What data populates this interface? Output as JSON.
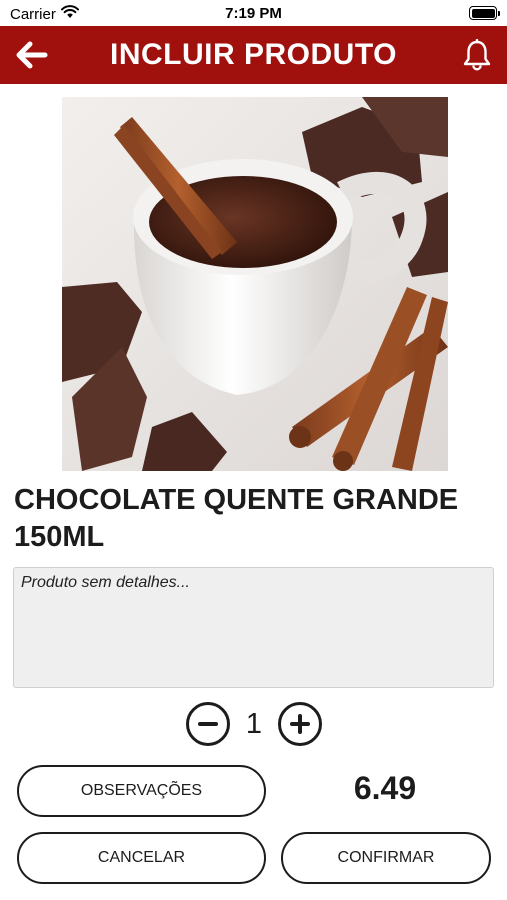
{
  "status_bar": {
    "carrier": "Carrier",
    "time": "7:19 PM",
    "icons": [
      "wifi-icon",
      "battery-icon"
    ]
  },
  "header": {
    "title": "INCLUIR PRODUTO",
    "background": "#a0100c",
    "icons": [
      "arrow-left-icon",
      "bell-icon"
    ]
  },
  "product": {
    "image_alt": "hot-chocolate-photo",
    "name": "CHOCOLATE QUENTE GRANDE 150ML",
    "details": "Produto sem detalhes...",
    "price": "6.49"
  },
  "quantity": {
    "value": "1",
    "icons": [
      "minus-icon",
      "plus-icon"
    ]
  },
  "buttons": {
    "observations": "OBSERVAÇÕES",
    "cancel": "CANCELAR",
    "confirm": "CONFIRMAR"
  }
}
